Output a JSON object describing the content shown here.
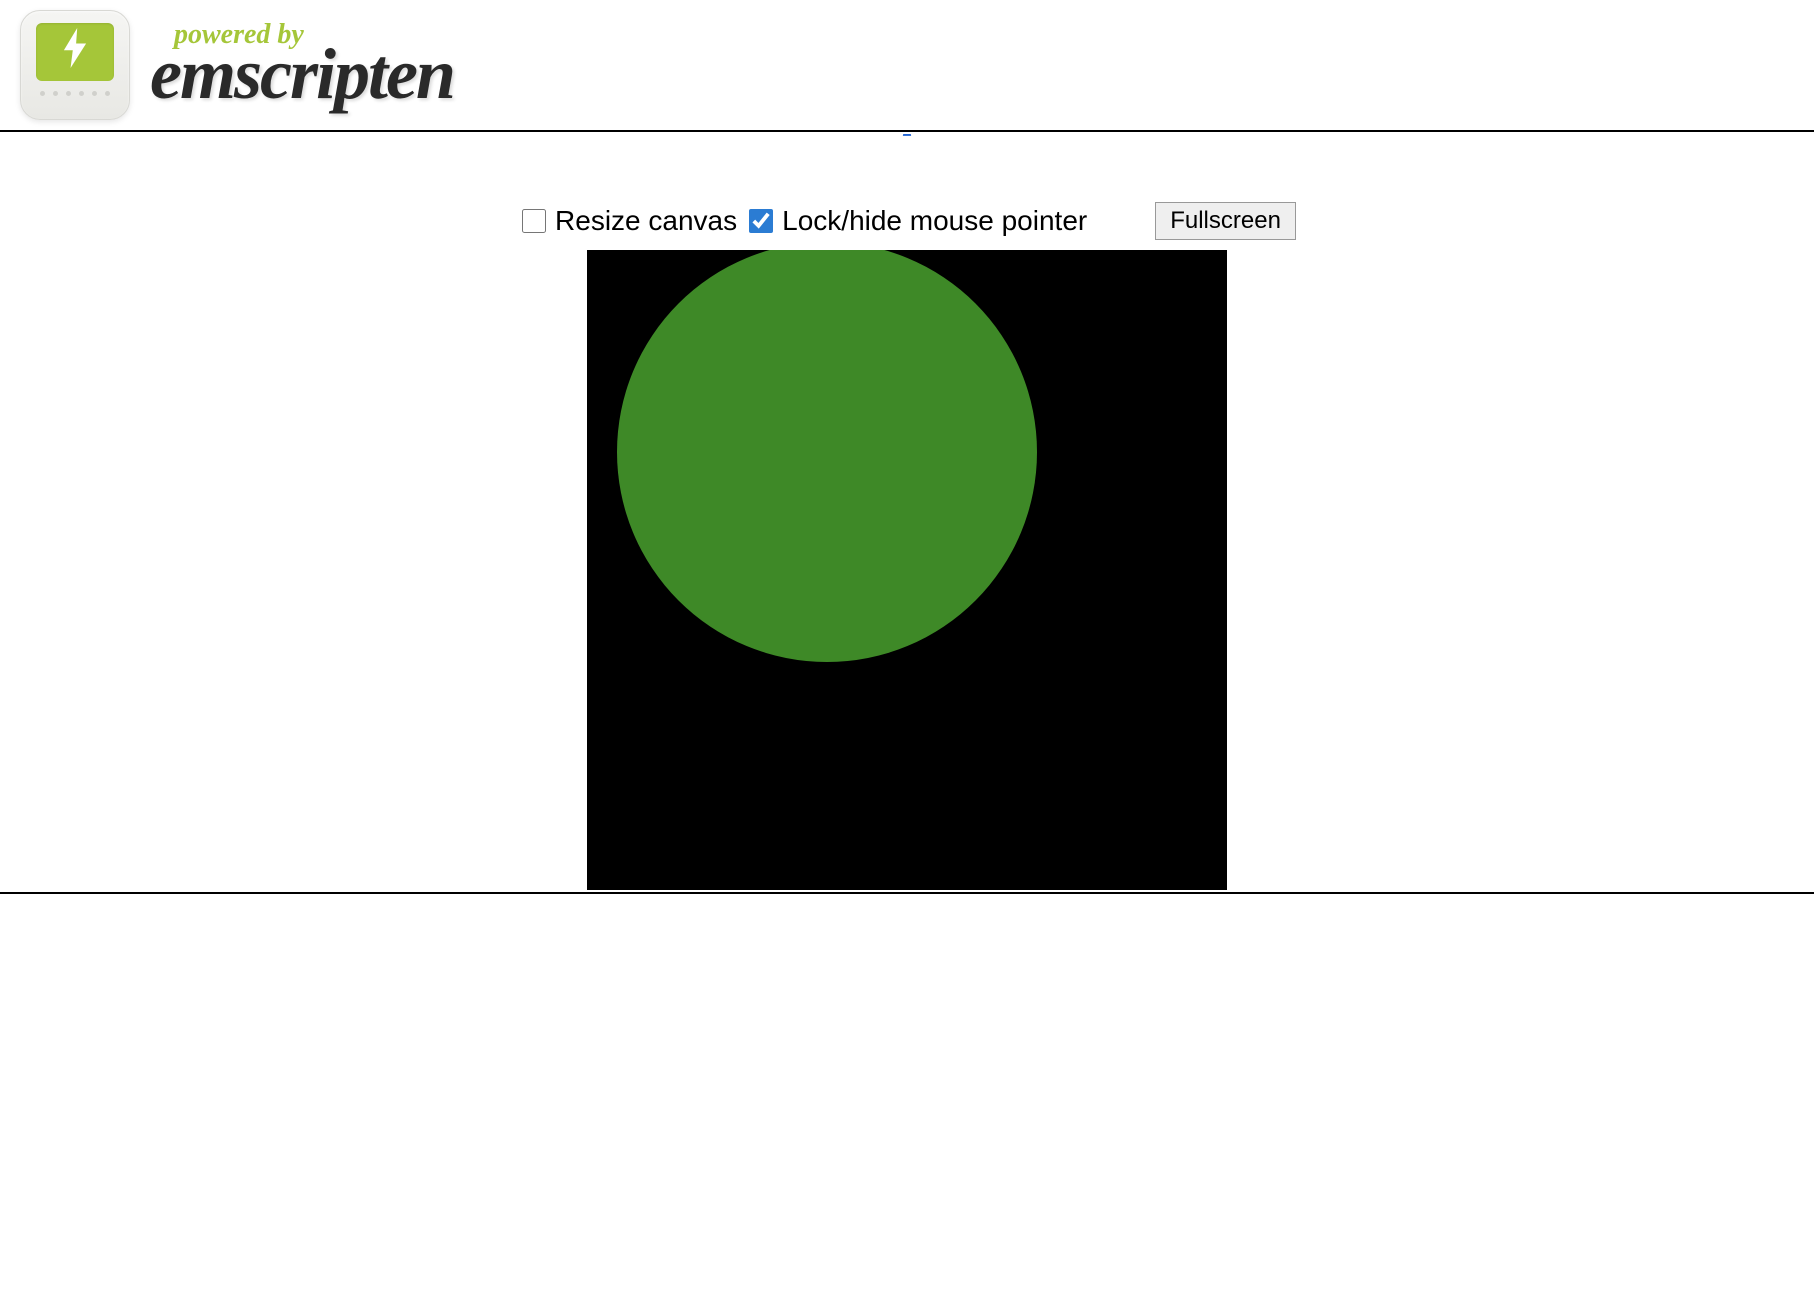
{
  "header": {
    "powered_by": "powered by",
    "brand": "emscripten"
  },
  "controls": {
    "link_dash": "_",
    "resize_canvas_label": "Resize canvas",
    "resize_canvas_checked": false,
    "lock_pointer_label": "Lock/hide mouse pointer",
    "lock_pointer_checked": true,
    "fullscreen_label": "Fullscreen"
  },
  "canvas": {
    "background": "#000000",
    "circle_color": "#3e8927"
  }
}
